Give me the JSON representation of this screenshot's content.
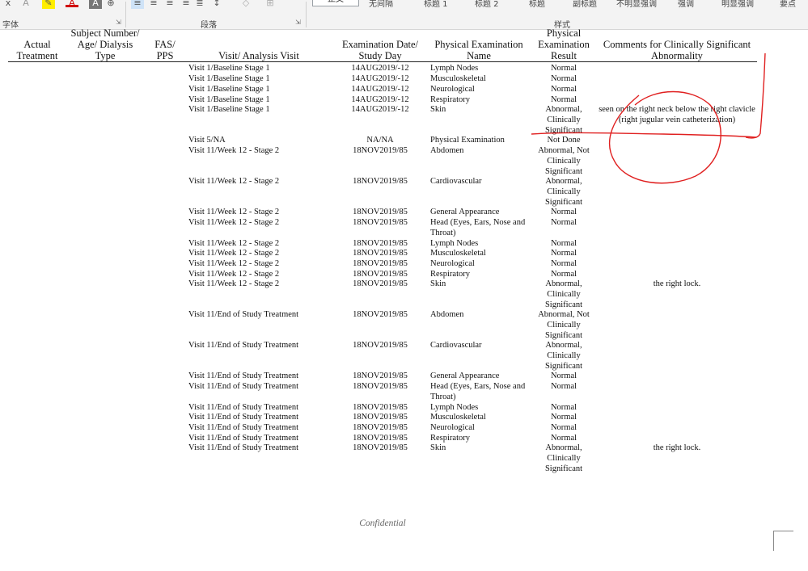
{
  "ribbon": {
    "font_group_label": "字体",
    "paragraph_group_label": "段落",
    "styles_group_label": "样式",
    "style_gallery": [
      "正文",
      "无间隔",
      "标题 1",
      "标题 2",
      "标题",
      "副标题",
      "不明显强调",
      "强调",
      "明显强调",
      "要点"
    ],
    "icons": {
      "close": "x",
      "font_color_letter": "A"
    }
  },
  "table": {
    "headers": {
      "actual_treatment": "Actual Treatment",
      "subject": "Subject Number/ Age/ Dialysis Type",
      "fas_pps": "FAS/ PPS",
      "visit": "Visit/ Analysis Visit",
      "exam_date": "Examination Date/ Study Day",
      "exam_name": "Physical Examination Name",
      "exam_result": "Physical Examination Result",
      "comments": "Comments for Clinically Significant Abnormality"
    },
    "rows": [
      {
        "visit": "Visit 1/Baseline Stage 1",
        "date": "14AUG2019/-12",
        "name": "Lymph Nodes",
        "result": "Normal",
        "comment": ""
      },
      {
        "visit": "Visit 1/Baseline Stage 1",
        "date": "14AUG2019/-12",
        "name": "Musculoskeletal",
        "result": "Normal",
        "comment": ""
      },
      {
        "visit": "Visit 1/Baseline Stage 1",
        "date": "14AUG2019/-12",
        "name": "Neurological",
        "result": "Normal",
        "comment": ""
      },
      {
        "visit": "Visit 1/Baseline Stage 1",
        "date": "14AUG2019/-12",
        "name": "Respiratory",
        "result": "Normal",
        "comment": ""
      },
      {
        "visit": "Visit 1/Baseline Stage 1",
        "date": "14AUG2019/-12",
        "name": "Skin",
        "result": "Abnormal, Clinically Significant",
        "comment": "seen on the right neck below the right clavicle (right jugular vein catheterization)"
      },
      {
        "visit": "Visit 5/NA",
        "date": "NA/NA",
        "name": "Physical Examination",
        "result": "Not Done",
        "comment": ""
      },
      {
        "visit": "Visit 11/Week 12 - Stage 2",
        "date": "18NOV2019/85",
        "name": "Abdomen",
        "result": "Abnormal, Not Clinically Significant",
        "comment": ""
      },
      {
        "visit": "Visit 11/Week 12 - Stage 2",
        "date": "18NOV2019/85",
        "name": "Cardiovascular",
        "result": "Abnormal, Clinically Significant",
        "comment": ""
      },
      {
        "visit": "Visit 11/Week 12 - Stage 2",
        "date": "18NOV2019/85",
        "name": "General Appearance",
        "result": "Normal",
        "comment": ""
      },
      {
        "visit": "Visit 11/Week 12 - Stage 2",
        "date": "18NOV2019/85",
        "name": "Head (Eyes, Ears, Nose and Throat)",
        "result": "Normal",
        "comment": ""
      },
      {
        "visit": "Visit 11/Week 12 - Stage 2",
        "date": "18NOV2019/85",
        "name": "Lymph Nodes",
        "result": "Normal",
        "comment": ""
      },
      {
        "visit": "Visit 11/Week 12 - Stage 2",
        "date": "18NOV2019/85",
        "name": "Musculoskeletal",
        "result": "Normal",
        "comment": ""
      },
      {
        "visit": "Visit 11/Week 12 - Stage 2",
        "date": "18NOV2019/85",
        "name": "Neurological",
        "result": "Normal",
        "comment": ""
      },
      {
        "visit": "Visit 11/Week 12 - Stage 2",
        "date": "18NOV2019/85",
        "name": "Respiratory",
        "result": "Normal",
        "comment": ""
      },
      {
        "visit": "Visit 11/Week 12 - Stage 2",
        "date": "18NOV2019/85",
        "name": "Skin",
        "result": "Abnormal, Clinically Significant",
        "comment": "the right lock."
      },
      {
        "visit": "Visit 11/End of Study Treatment",
        "date": "18NOV2019/85",
        "name": "Abdomen",
        "result": "Abnormal, Not Clinically Significant",
        "comment": ""
      },
      {
        "visit": "Visit 11/End of Study Treatment",
        "date": "18NOV2019/85",
        "name": "Cardiovascular",
        "result": "Abnormal, Clinically Significant",
        "comment": ""
      },
      {
        "visit": "Visit 11/End of Study Treatment",
        "date": "18NOV2019/85",
        "name": "General Appearance",
        "result": "Normal",
        "comment": ""
      },
      {
        "visit": "Visit 11/End of Study Treatment",
        "date": "18NOV2019/85",
        "name": "Head (Eyes, Ears, Nose and Throat)",
        "result": "Normal",
        "comment": ""
      },
      {
        "visit": "Visit 11/End of Study Treatment",
        "date": "18NOV2019/85",
        "name": "Lymph Nodes",
        "result": "Normal",
        "comment": ""
      },
      {
        "visit": "Visit 11/End of Study Treatment",
        "date": "18NOV2019/85",
        "name": "Musculoskeletal",
        "result": "Normal",
        "comment": ""
      },
      {
        "visit": "Visit 11/End of Study Treatment",
        "date": "18NOV2019/85",
        "name": "Neurological",
        "result": "Normal",
        "comment": ""
      },
      {
        "visit": "Visit 11/End of Study Treatment",
        "date": "18NOV2019/85",
        "name": "Respiratory",
        "result": "Normal",
        "comment": ""
      },
      {
        "visit": "Visit 11/End of Study Treatment",
        "date": "18NOV2019/85",
        "name": "Skin",
        "result": "Abnormal, Clinically Significant",
        "comment": "the right lock."
      }
    ]
  },
  "footer": {
    "confidential": "Confidential"
  },
  "annotation": {
    "color": "#e02020"
  }
}
